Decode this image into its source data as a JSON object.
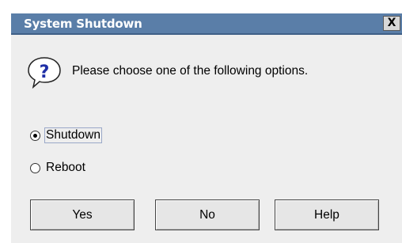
{
  "dialog": {
    "title": "System Shutdown",
    "close_glyph": "X",
    "icon": "question-icon",
    "icon_glyph": "?",
    "message": "Please choose one of the following options."
  },
  "options": [
    {
      "label": "Shutdown",
      "selected": true
    },
    {
      "label": "Reboot",
      "selected": false
    }
  ],
  "buttons": {
    "yes_label": "Yes",
    "no_label": "No",
    "help_label": "Help"
  },
  "colors": {
    "titlebar": "#5a7ea8",
    "dialog_background": "#eeeeee",
    "icon_accent": "#1f2fa6"
  }
}
